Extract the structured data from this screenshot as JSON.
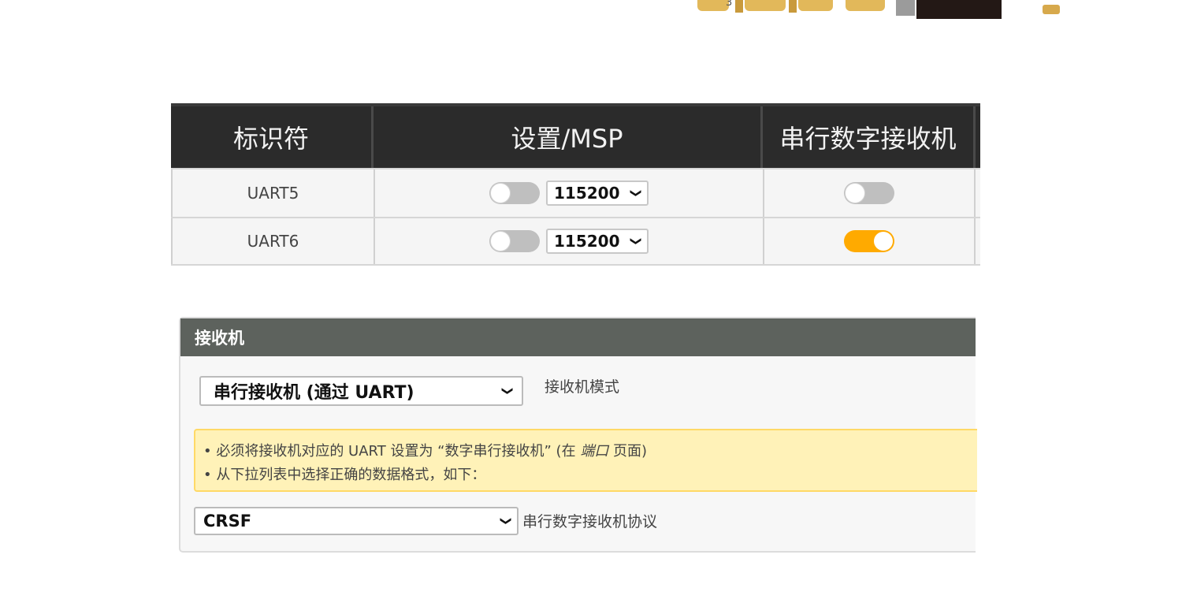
{
  "top_strip": {
    "number": "3"
  },
  "ports_table": {
    "headers": [
      "标识符",
      "设置/MSP",
      "串行数字接收机"
    ],
    "rows": [
      {
        "identifier": "UART5",
        "msp_enabled": false,
        "baud": "115200",
        "serial_rx_enabled": false
      },
      {
        "identifier": "UART6",
        "msp_enabled": false,
        "baud": "115200",
        "serial_rx_enabled": true
      }
    ]
  },
  "receiver": {
    "title": "接收机",
    "mode_select": {
      "value": "串行接收机 (通过 UART)",
      "label": "接收机模式"
    },
    "note": {
      "line1_before": "• 必须将接收机对应的 UART 设置为 “数字串行接收机” (在 ",
      "line1_italic": "端口",
      "line1_after": " 页面)",
      "line2": "• 从下拉列表中选择正确的数据格式，如下："
    },
    "protocol_select": {
      "value": "CRSF",
      "label": "串行数字接收机协议"
    }
  },
  "colors": {
    "toggle_on": "#ffaa00",
    "toggle_off": "#bfbfbf",
    "header_dark": "#2b2b2b",
    "panel_header": "#5d625d",
    "note_bg": "#fff2b8"
  }
}
